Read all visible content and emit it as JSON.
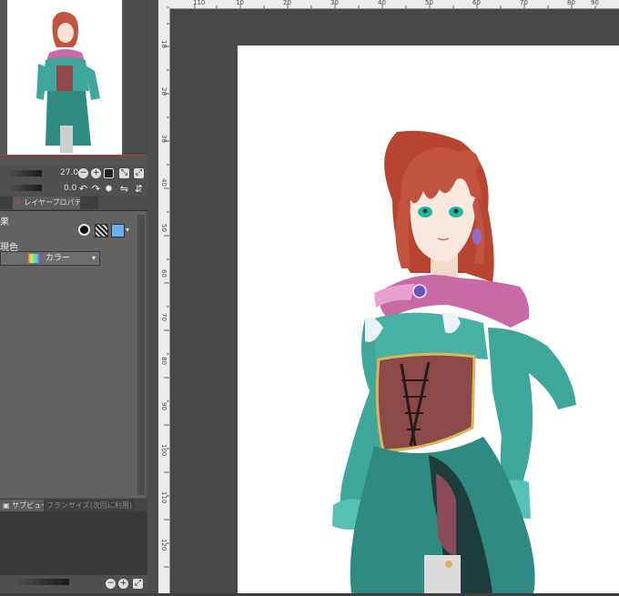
{
  "navigator": {
    "zoom_value": "27.0",
    "rotation_value": "0.0"
  },
  "tabs": {
    "layer_property": "レイヤープロパティ"
  },
  "properties": {
    "effect_label": "果",
    "display_color_label": "現色",
    "color_mode_value": "カラー"
  },
  "bottom_tabs": {
    "subview": "サブビュー",
    "other": "フランサイズ(次回に利用)"
  },
  "rulers": {
    "horizontal_ticks": [
      "110",
      "10",
      "20",
      "30",
      "40",
      "50",
      "60",
      "70",
      "80",
      "90",
      "100"
    ],
    "vertical_ticks": [
      "10",
      "20",
      "30",
      "40",
      "50",
      "60",
      "70",
      "80",
      "90",
      "100",
      "110",
      "120"
    ]
  },
  "icons": {
    "zoom_out": "zoom-out-icon",
    "zoom_in": "zoom-in-icon",
    "fit": "fit-screen-icon",
    "rotate_left": "rotate-left-icon",
    "rotate_right": "rotate-right-icon",
    "reset": "reset-rotation-icon",
    "flip": "flip-icon"
  },
  "colors": {
    "hair": "#c2533f",
    "dress": "#3fa69a",
    "scarf": "#c96aa7",
    "corset": "#8b4a47",
    "accent_red": "#c8332f"
  }
}
